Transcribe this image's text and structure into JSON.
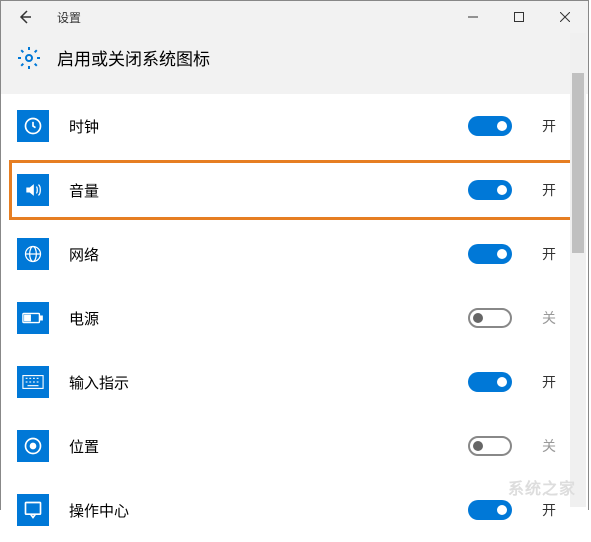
{
  "window": {
    "title": "设置"
  },
  "header": {
    "title": "启用或关闭系统图标"
  },
  "labels": {
    "on": "开",
    "off": "关"
  },
  "items": [
    {
      "icon": "clock-icon",
      "label": "时钟",
      "state": "on",
      "hl": false
    },
    {
      "icon": "volume-icon",
      "label": "音量",
      "state": "on",
      "hl": true
    },
    {
      "icon": "globe-icon",
      "label": "网络",
      "state": "on",
      "hl": false
    },
    {
      "icon": "battery-icon",
      "label": "电源",
      "state": "off",
      "hl": false
    },
    {
      "icon": "ime-icon",
      "label": "输入指示",
      "state": "on",
      "hl": false
    },
    {
      "icon": "location-icon",
      "label": "位置",
      "state": "off",
      "hl": false
    },
    {
      "icon": "action-icon",
      "label": "操作中心",
      "state": "on",
      "hl": false
    }
  ],
  "watermark": "系统之家"
}
